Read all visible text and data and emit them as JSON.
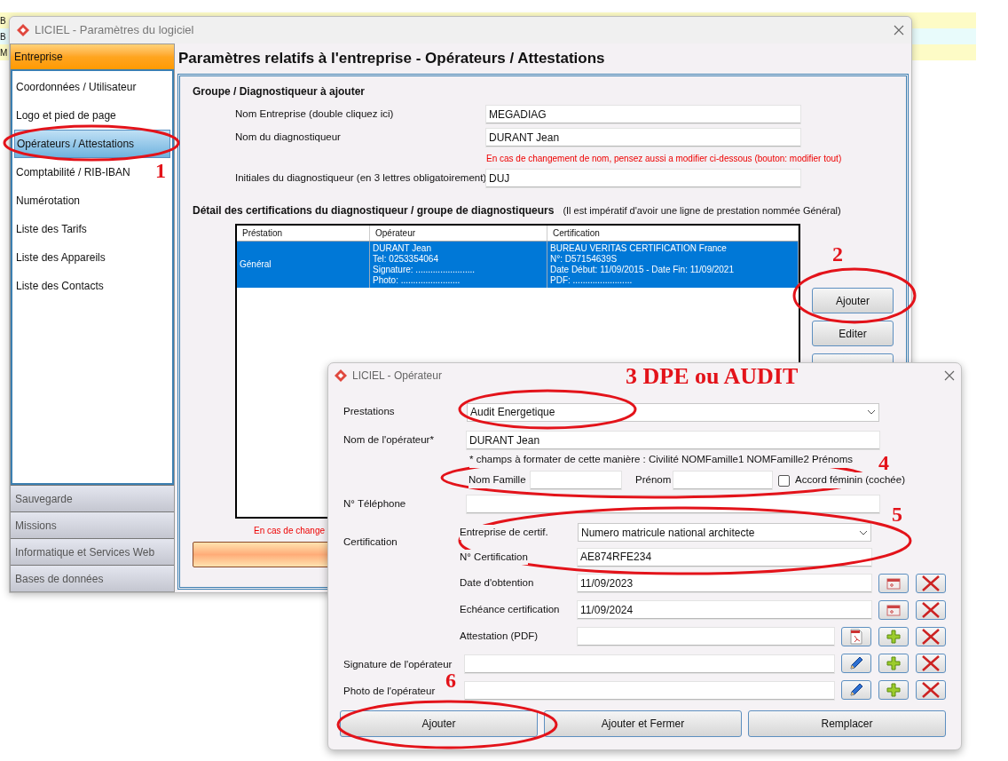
{
  "background_rows": [
    {
      "text": "B"
    },
    {
      "text": "B"
    },
    {
      "text": "M"
    }
  ],
  "main_window": {
    "title": "LICIEL - Paramètres du logiciel",
    "sidebar": {
      "header": "Entreprise",
      "items": [
        {
          "label": "Coordonnées / Utilisateur",
          "selected": false
        },
        {
          "label": "Logo et pied de page",
          "selected": false
        },
        {
          "label": "Opérateurs / Attestations",
          "selected": true
        },
        {
          "label": "Comptabilité / RIB-IBAN",
          "selected": false
        },
        {
          "label": "Numérotation",
          "selected": false
        },
        {
          "label": "Liste des Tarifs",
          "selected": false
        },
        {
          "label": "Liste des Appareils",
          "selected": false
        },
        {
          "label": "Liste des Contacts",
          "selected": false
        }
      ],
      "sections": [
        "Sauvegarde",
        "Missions",
        "Informatique et Services Web",
        "Bases de données"
      ]
    },
    "heading": "Paramètres relatifs à l'entreprise - Opérateurs / Attestations",
    "group_title": "Groupe / Diagnostiqueur à ajouter",
    "fields": [
      {
        "label": "Nom Entreprise (double cliquez ici)",
        "value": "MEGADIAG"
      },
      {
        "label": "Nom du diagnostiqueur",
        "value": "DURANT Jean",
        "note": "En cas de changement de nom, pensez aussi a modifier ci-dessous (bouton: modifier tout)"
      },
      {
        "label": "Initiales du diagnostiqueur (en 3 lettres obligatoirement)",
        "value": "DUJ"
      }
    ],
    "detail_title": "Détail des certifications du diagnostiqueur / groupe de diagnostiqueurs",
    "detail_note": "(Il est impératif d'avoir une ligne de prestation nommée Général)",
    "table": {
      "columns": [
        "Préstation",
        "Opérateur",
        "Certification"
      ],
      "rows": [
        {
          "selected": true,
          "cells": [
            [
              "Général"
            ],
            [
              "DURANT Jean",
              "Tel: 0253354064",
              "Signature: ........................",
              "Photo: ........................"
            ],
            [
              "BUREAU VERITAS CERTIFICATION France",
              "N°: D57154639S",
              "Date Début: 11/09/2015 - Date Fin: 11/09/2021",
              "PDF: ........................"
            ]
          ]
        }
      ]
    },
    "buttons": [
      "Ajouter",
      "Editer"
    ],
    "footer_note": "En cas de change"
  },
  "dialog": {
    "title": "LICIEL - Opérateur",
    "prestations": {
      "label": "Prestations",
      "value": "Audit Energetique"
    },
    "operator": {
      "label": "Nom de l'opérateur*",
      "value": "DURANT Jean",
      "hint": "* champs à formater de cette manière : Civilité NOMFamille1 NOMFamille2 Prénoms"
    },
    "name_split": {
      "family_label": "Nom Famille",
      "first_label": "Prénom",
      "checkbox": {
        "label": "Accord féminin (cochée)",
        "checked": false
      }
    },
    "phone": {
      "label": "N° Téléphone"
    },
    "certification": {
      "label": "Certification",
      "company": {
        "label": "Entreprise de certif.",
        "value": "Numero matricule national architecte"
      },
      "number": {
        "label": "N° Certification",
        "value": "AE874RFE234"
      },
      "dates": [
        {
          "label": "Date d'obtention",
          "value": "11/09/2023"
        },
        {
          "label": "Echéance certification",
          "value": "11/09/2024"
        }
      ],
      "attestation": {
        "label": "Attestation (PDF)"
      }
    },
    "signature": {
      "label": "Signature de l'opérateur"
    },
    "photo": {
      "label": "Photo de l'opérateur"
    },
    "buttons": [
      "Ajouter",
      "Ajouter et Fermer",
      "Remplacer"
    ]
  },
  "annotations": [
    {
      "text": "1"
    },
    {
      "text": "2"
    },
    {
      "text": "3 DPE ou AUDIT"
    },
    {
      "text": "4"
    },
    {
      "text": "5"
    },
    {
      "text": "6"
    }
  ]
}
